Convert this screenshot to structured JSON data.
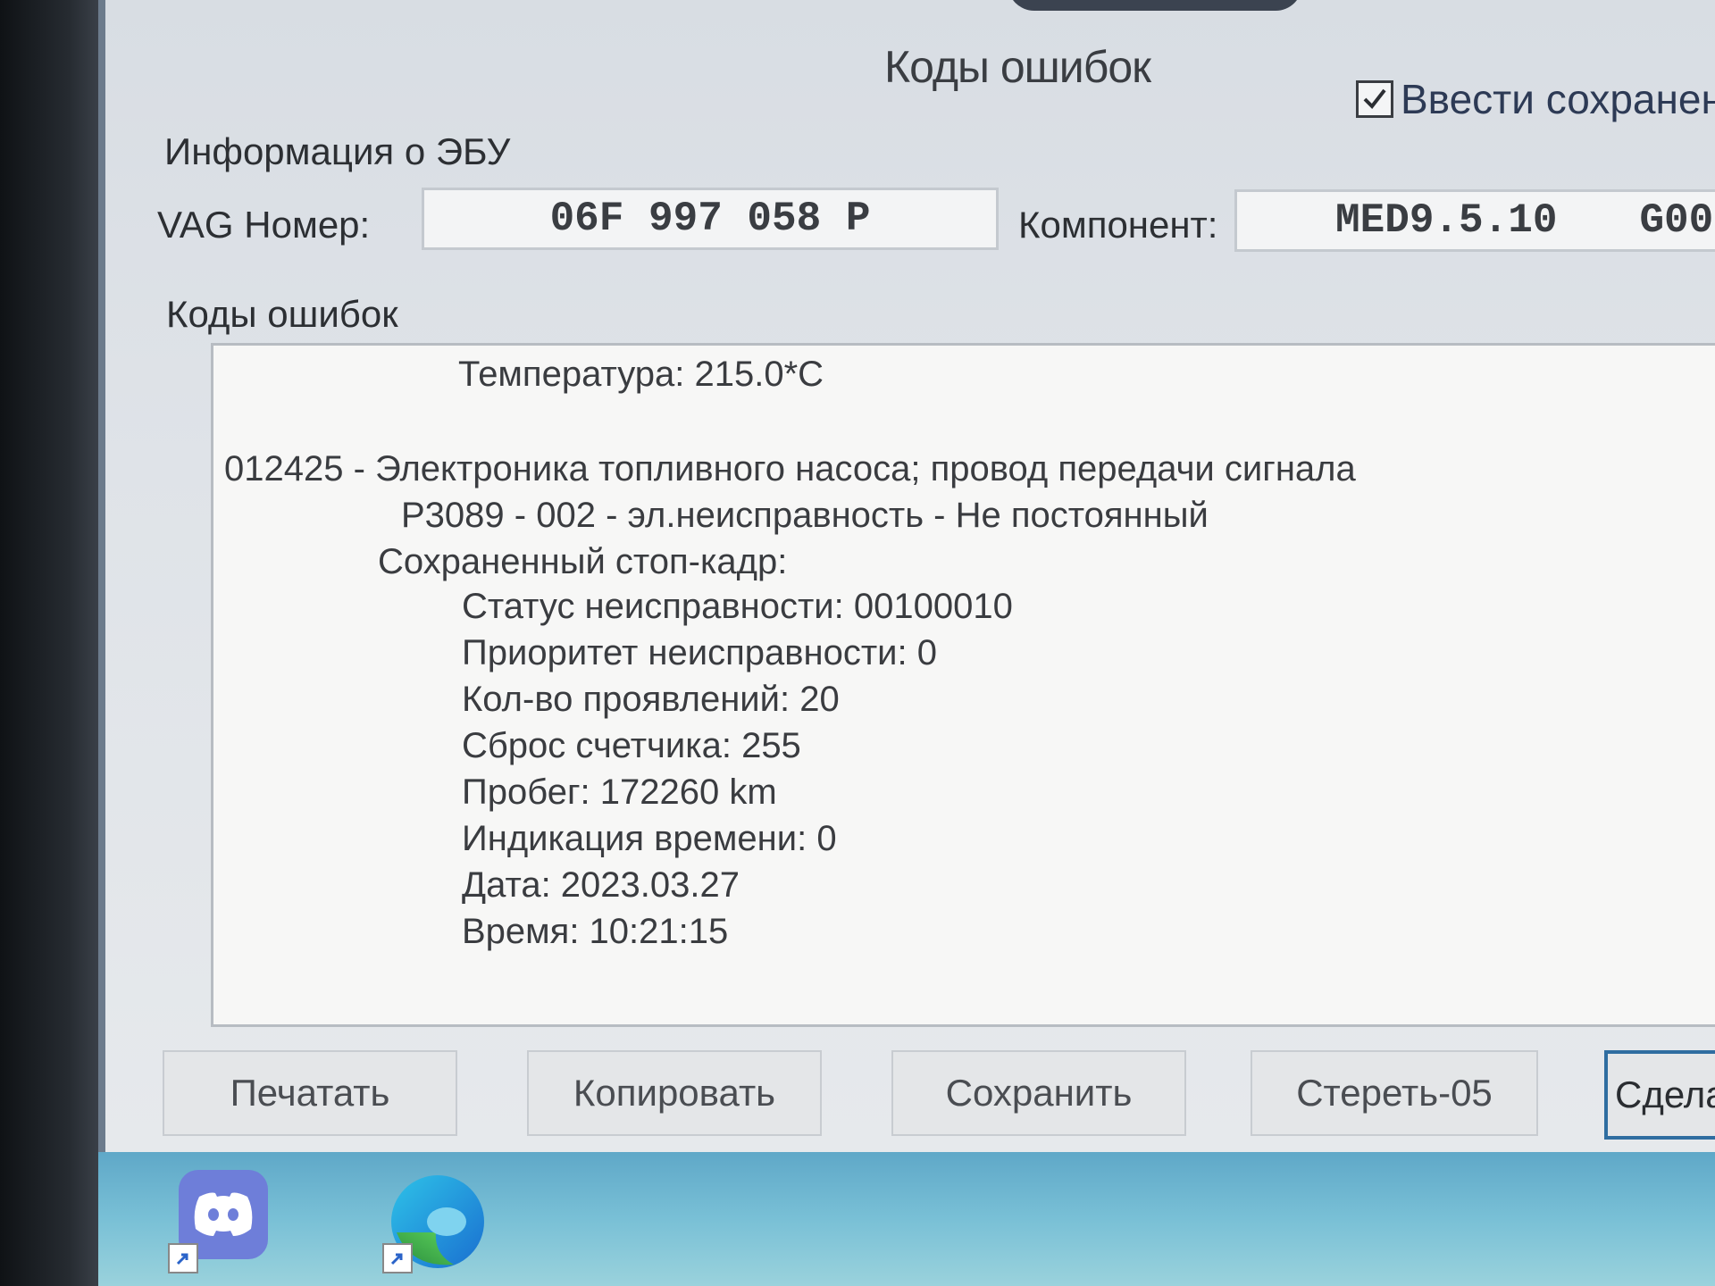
{
  "window": {
    "title": "Коды ошибок",
    "checkbox_label": "Ввести сохраненн",
    "checkbox_checked": true
  },
  "ecu_info": {
    "section_label": "Информация о ЭБУ",
    "vag_label": "VAG Номер:",
    "vag_value": "06F 997 058 P",
    "component_label": "Компонент:",
    "component_value": "MED9.5.10",
    "component_extra": "G00"
  },
  "codes": {
    "section_label": "Коды ошибок",
    "temperature": "Температура: 215.0*C",
    "fault_line": "012425 - Электроника топливного насоса; провод передачи сигнала",
    "p_code_line": "P3089 - 002 - эл.неисправность - Не постоянный",
    "freeze_frame_label": "Сохраненный стоп-кадр:",
    "freeze_frame": [
      "Статус неисправности: 00100010",
      "Приоритет неисправности: 0",
      "Кол-во проявлений: 20",
      "Сброс счетчика: 255",
      "Пробег: 172260 km",
      "Индикация времени: 0",
      "Дата: 2023.03.27",
      "Время: 10:21:15"
    ]
  },
  "buttons": {
    "print": "Печатать",
    "copy": "Копировать",
    "save": "Сохранить",
    "erase": "Стереть-05",
    "done": "Сдела"
  },
  "desktop": {
    "icons": [
      "discord-icon",
      "edge-icon"
    ]
  },
  "colors": {
    "window_bg": "#dfe3e8",
    "text_box_bg": "#f7f7f6",
    "accent_border": "#2f6da0",
    "desktop_bg": "#79c0d6"
  }
}
